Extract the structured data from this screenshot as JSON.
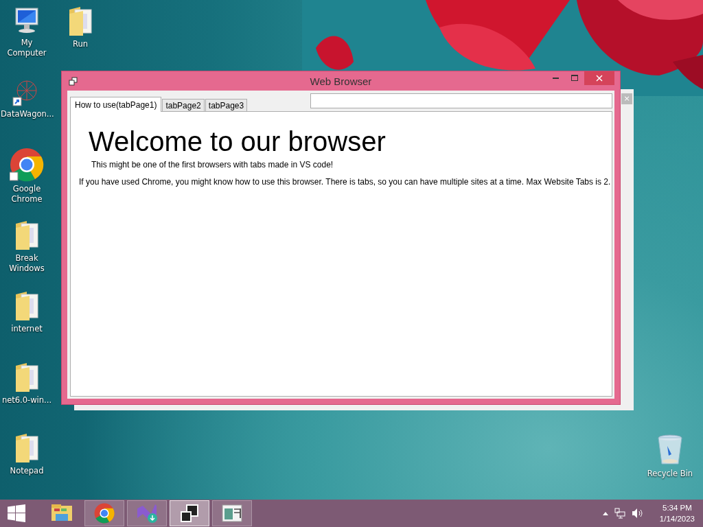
{
  "desktop_icons": [
    {
      "label": "My Computer",
      "kind": "computer"
    },
    {
      "label": "Run",
      "kind": "folder"
    },
    {
      "label": "DataWagon...",
      "kind": "app"
    },
    {
      "label": "Google Chrome",
      "kind": "chrome"
    },
    {
      "label": "Break Windows",
      "kind": "folder"
    },
    {
      "label": "internet",
      "kind": "folder"
    },
    {
      "label": "net6.0-win...",
      "kind": "folder"
    },
    {
      "label": "Notepad",
      "kind": "folder"
    },
    {
      "label": "Recycle Bin",
      "kind": "recycle"
    }
  ],
  "back_window": {
    "close": "×"
  },
  "window": {
    "title": "Web Browser",
    "tabs": [
      {
        "label": "How to use(tabPage1)",
        "selected": true
      },
      {
        "label": "tabPage2",
        "selected": false
      },
      {
        "label": "tabPage3",
        "selected": false
      }
    ],
    "content": {
      "heading": "Welcome to our browser",
      "subtitle": "This might be one of the first browsers with tabs made in VS code!",
      "body": "If you have used Chrome, you might know how to use this browser. There is tabs, so you can have multiple sites at a time. Max Website Tabs is 2."
    }
  },
  "taskbar": {
    "items": [
      {
        "kind": "explorer",
        "running": false,
        "selected": false
      },
      {
        "kind": "chrome",
        "running": true,
        "selected": false
      },
      {
        "kind": "studio",
        "running": true,
        "selected": false
      },
      {
        "kind": "windows",
        "running": true,
        "selected": true
      },
      {
        "kind": "form",
        "running": true,
        "selected": false
      }
    ],
    "clock": {
      "time": "5:34 PM",
      "date": "1/14/2023"
    }
  }
}
